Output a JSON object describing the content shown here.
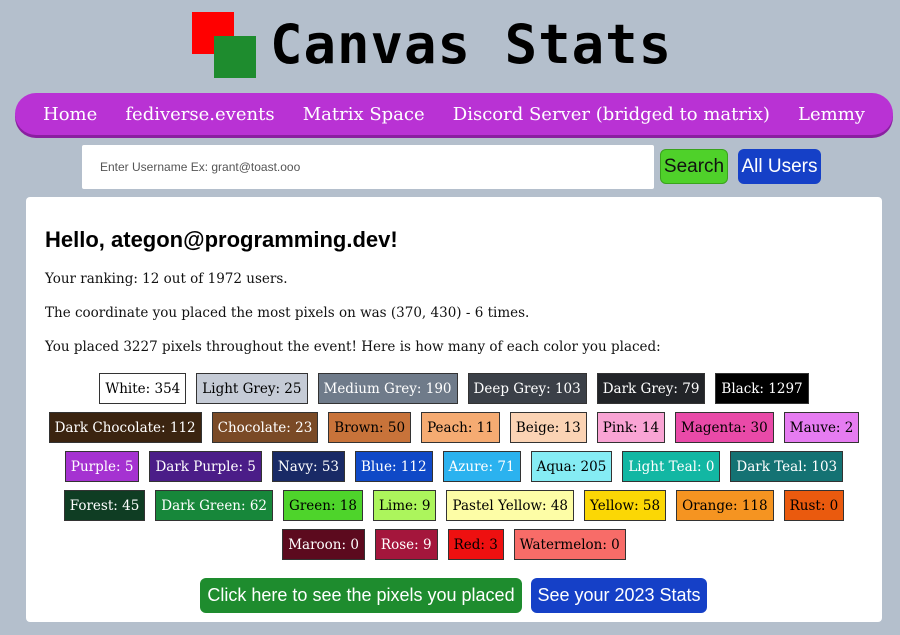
{
  "header": {
    "title": "Canvas Stats"
  },
  "nav": {
    "items": [
      "Home",
      "fediverse.events",
      "Matrix Space",
      "Discord Server (bridged to matrix)",
      "Lemmy"
    ]
  },
  "search": {
    "placeholder": "Enter Username Ex: grant@toast.ooo",
    "search_label": "Search",
    "all_users_label": "All Users"
  },
  "stats": {
    "greeting": "Hello, ategon@programming.dev!",
    "ranking": "Your ranking: 12 out of 1972 users.",
    "coordinate": "The coordinate you placed the most pixels on was (370, 430) - 6 times.",
    "placed": "You placed 3227 pixels throughout the event! Here is how many of each color you placed:"
  },
  "colors": [
    [
      {
        "label": "White: 354",
        "bg": "#ffffff",
        "fg": "#000000"
      },
      {
        "label": "Light Grey: 25",
        "bg": "#c5cbd6",
        "fg": "#000000"
      },
      {
        "label": "Medium Grey: 190",
        "bg": "#6f7b8a",
        "fg": "#ffffff"
      },
      {
        "label": "Deep Grey: 103",
        "bg": "#3b4048",
        "fg": "#ffffff"
      },
      {
        "label": "Dark Grey: 79",
        "bg": "#222428",
        "fg": "#ffffff"
      },
      {
        "label": "Black: 1297",
        "bg": "#000000",
        "fg": "#ffffff"
      }
    ],
    [
      {
        "label": "Dark Chocolate: 112",
        "bg": "#3b2410",
        "fg": "#ffffff"
      },
      {
        "label": "Chocolate: 23",
        "bg": "#7a4a26",
        "fg": "#ffffff"
      },
      {
        "label": "Brown: 50",
        "bg": "#c8733a",
        "fg": "#000000"
      },
      {
        "label": "Peach: 11",
        "bg": "#f5ab72",
        "fg": "#000000"
      },
      {
        "label": "Beige: 13",
        "bg": "#fbd3b4",
        "fg": "#000000"
      },
      {
        "label": "Pink: 14",
        "bg": "#f9a4d4",
        "fg": "#000000"
      },
      {
        "label": "Magenta: 30",
        "bg": "#e94aa8",
        "fg": "#000000"
      },
      {
        "label": "Mauve: 2",
        "bg": "#e67cf1",
        "fg": "#000000"
      }
    ],
    [
      {
        "label": "Purple: 5",
        "bg": "#a532d1",
        "fg": "#ffffff"
      },
      {
        "label": "Dark Purple: 5",
        "bg": "#4b1d88",
        "fg": "#ffffff"
      },
      {
        "label": "Navy: 53",
        "bg": "#192a66",
        "fg": "#ffffff"
      },
      {
        "label": "Blue: 112",
        "bg": "#0f49c7",
        "fg": "#ffffff"
      },
      {
        "label": "Azure: 71",
        "bg": "#2bb2ef",
        "fg": "#ffffff"
      },
      {
        "label": "Aqua: 205",
        "bg": "#85ecf4",
        "fg": "#000000"
      },
      {
        "label": "Light Teal: 0",
        "bg": "#12b7a3",
        "fg": "#ffffff"
      },
      {
        "label": "Dark Teal: 103",
        "bg": "#147273",
        "fg": "#ffffff"
      }
    ],
    [
      {
        "label": "Forest: 45",
        "bg": "#0f3d23",
        "fg": "#ffffff"
      },
      {
        "label": "Dark Green: 62",
        "bg": "#17873a",
        "fg": "#ffffff"
      },
      {
        "label": "Green: 18",
        "bg": "#4ed42b",
        "fg": "#000000"
      },
      {
        "label": "Lime: 9",
        "bg": "#acf55c",
        "fg": "#000000"
      },
      {
        "label": "Pastel Yellow: 48",
        "bg": "#fdfda6",
        "fg": "#000000"
      },
      {
        "label": "Yellow: 58",
        "bg": "#fbd705",
        "fg": "#000000"
      },
      {
        "label": "Orange: 118",
        "bg": "#f59421",
        "fg": "#000000"
      },
      {
        "label": "Rust: 0",
        "bg": "#ea5a0e",
        "fg": "#000000"
      }
    ],
    [
      {
        "label": "Maroon: 0",
        "bg": "#5c0a1e",
        "fg": "#ffffff"
      },
      {
        "label": "Rose: 9",
        "bg": "#a4163c",
        "fg": "#ffffff"
      },
      {
        "label": "Red: 3",
        "bg": "#ee1010",
        "fg": "#000000"
      },
      {
        "label": "Watermelon: 0",
        "bg": "#f86c68",
        "fg": "#000000"
      }
    ]
  ],
  "buttons": {
    "pixels": "Click here to see the pixels you placed",
    "stats2023": "See your 2023 Stats"
  }
}
